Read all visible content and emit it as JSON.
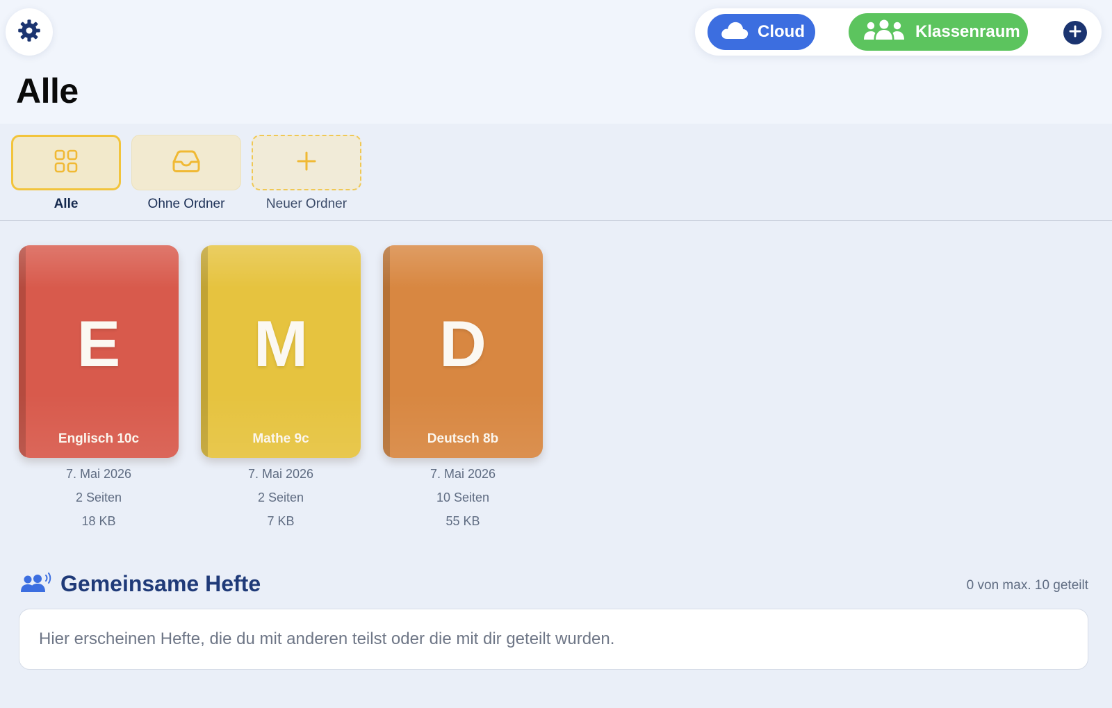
{
  "header": {
    "title": "Alle",
    "cloud_label": "Cloud",
    "classroom_label": "Klassenraum"
  },
  "colors": {
    "cloud": "#3c6ee0",
    "classroom": "#5cc45e",
    "accent_folder": "#f2c43c",
    "heading": "#1f3a78"
  },
  "folders": [
    {
      "label": "Alle",
      "icon": "grid-icon",
      "selected": true
    },
    {
      "label": "Ohne Ordner",
      "icon": "inbox-tray-icon",
      "selected": false
    },
    {
      "label": "Neuer Ordner",
      "icon": "plus-icon",
      "selected": false
    }
  ],
  "notebooks": [
    {
      "letter": "E",
      "title": "Englisch 10c",
      "date": "7. Mai 2026",
      "pages": "2 Seiten",
      "size": "18 KB",
      "color": "#d85a4c"
    },
    {
      "letter": "M",
      "title": "Mathe 9c",
      "date": "7. Mai 2026",
      "pages": "2 Seiten",
      "size": "7 KB",
      "color": "#e6c33f"
    },
    {
      "letter": "D",
      "title": "Deutsch 8b",
      "date": "7. Mai 2026",
      "pages": "10 Seiten",
      "size": "55 KB",
      "color": "#d88741"
    }
  ],
  "shared": {
    "title": "Gemeinsame Hefte",
    "count": "0 von max. 10 geteilt",
    "empty_text": "Hier erscheinen Hefte, die du mit anderen teilst oder die mit dir geteilt wurden."
  }
}
